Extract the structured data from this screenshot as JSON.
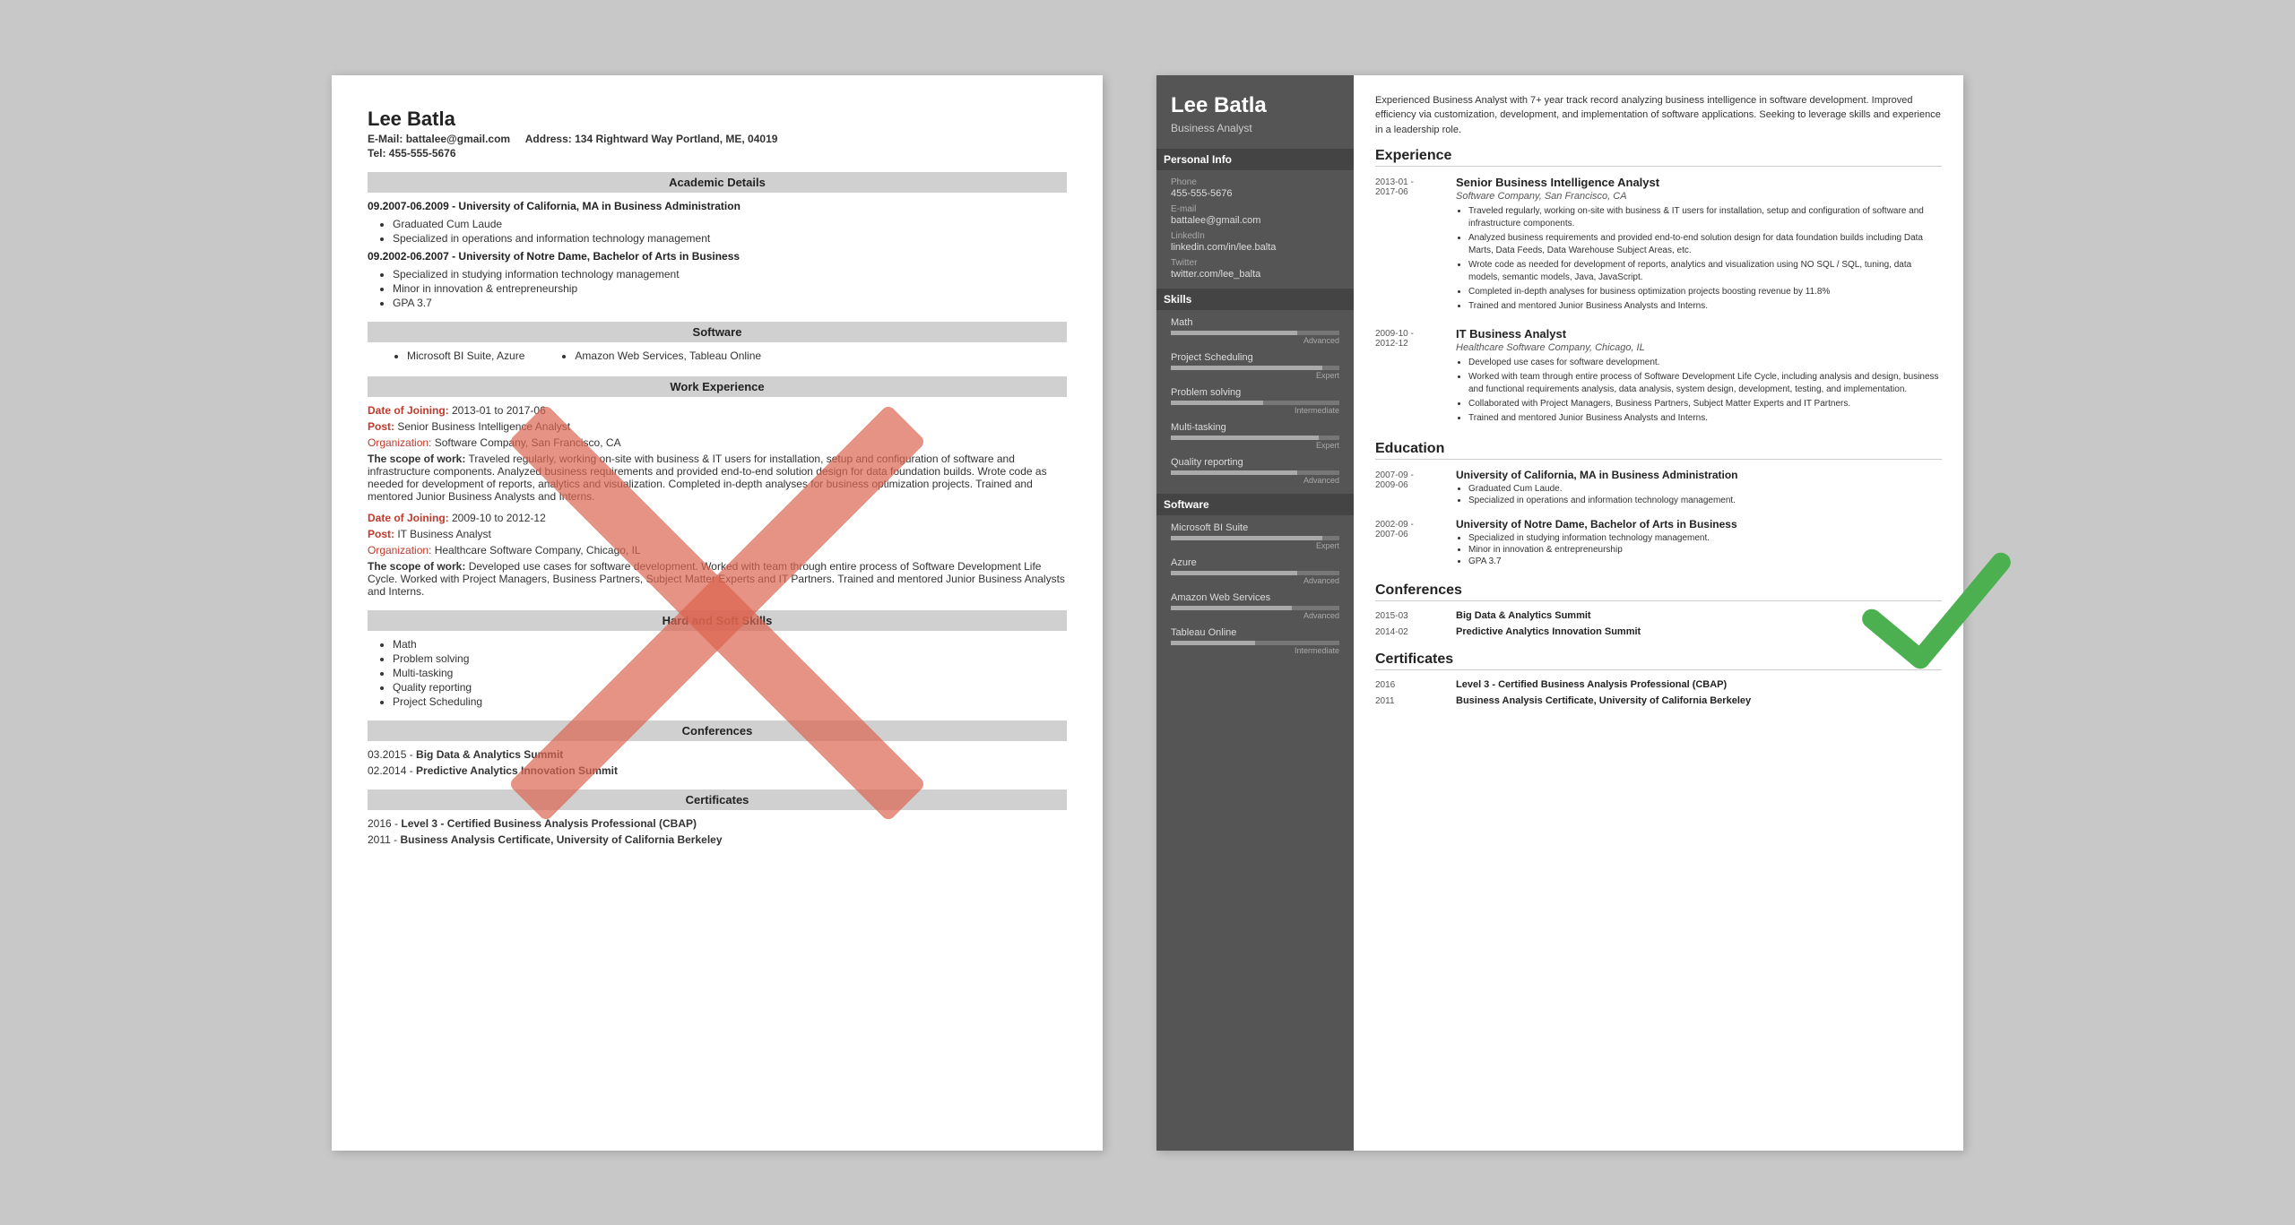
{
  "left_resume": {
    "name": "Lee Batla",
    "email_label": "E-Mail:",
    "email": "battalee@gmail.com",
    "address_label": "Address:",
    "address": "134 Rightward Way Portland, ME, 04019",
    "tel_label": "Tel:",
    "tel": "455-555-5676",
    "sections": {
      "academic": {
        "title": "Academic Details",
        "items": [
          {
            "date": "09.2007-06.2009",
            "degree": "University of California, MA in Business Administration",
            "bullets": [
              "Graduated Cum Laude",
              "Specialized in operations and information technology management"
            ]
          },
          {
            "date": "09.2002-06.2007",
            "degree": "University of Notre Dame, Bachelor of Arts in Business",
            "bullets": [
              "Specialized in studying information technology management",
              "Minor in innovation & entrepreneurship",
              "GPA 3.7"
            ]
          }
        ]
      },
      "software": {
        "title": "Software",
        "col1": [
          "Microsoft BI Suite, Azure"
        ],
        "col2": [
          "Amazon Web Services, Tableau Online"
        ]
      },
      "work": {
        "title": "Work Experience",
        "items": [
          {
            "dates": "Date of Joining: 2013-01 to 2017-06",
            "post": "Post: Senior Business Intelligence Analyst",
            "org": "Organization: Software Company, San Francisco, CA",
            "scope_label": "The scope of work:",
            "scope_text": "Traveled regularly, working on-site with business & IT users for installation, setup and configuration of software and infrastructure components. Analyzed business requirements and provided end-to-end solution design for data foundation builds. Wrote code as needed for development of reports, analytics and visualization. Completed in-depth analyses for business optimization projects. Trained and mentored Junior Business Analysts and Interns."
          },
          {
            "dates": "Date of Joining: 2009-10 to 2012-12",
            "post": "Post: IT Business Analyst",
            "org": "Organization: Healthcare Software Company, Chicago, IL",
            "scope_label": "The scope of work:",
            "scope_text": "Developed use cases for software development. Worked with team through entire process of Software Development Life Cycle. Worked with Project Managers, Business Partners, Subject Matter Experts and IT Partners. Trained and mentored Junior Business Analysts and Interns."
          }
        ]
      },
      "skills": {
        "title": "Hard and Soft Skills",
        "items": [
          "Math",
          "Problem solving",
          "Multi-tasking",
          "Quality reporting",
          "Project Scheduling"
        ]
      },
      "conferences": {
        "title": "Conferences",
        "items": [
          {
            "date": "03.2015",
            "name": "Big Data & Analytics Summit"
          },
          {
            "date": "02.2014",
            "name": "Predictive Analytics Innovation Summit"
          }
        ]
      },
      "certificates": {
        "title": "Certificates",
        "items": [
          {
            "date": "2016",
            "name": "Level 3 - Certified Business Analysis Professional (CBAP)"
          },
          {
            "date": "2011",
            "name": "Business Analysis Certificate, University of California Berkeley"
          }
        ]
      }
    }
  },
  "right_resume": {
    "name": "Lee Batla",
    "title": "Business Analyst",
    "summary": "Experienced Business Analyst with 7+ year track record analyzing business intelligence in software development. Improved efficiency via customization, development, and implementation of software applications. Seeking to leverage skills and experience in a leadership role.",
    "personal_info": {
      "section_title": "Personal Info",
      "phone_label": "Phone",
      "phone": "455-555-5676",
      "email_label": "E-mail",
      "email": "battalee@gmail.com",
      "linkedin_label": "LinkedIn",
      "linkedin": "linkedin.com/in/lee.balta",
      "twitter_label": "Twitter",
      "twitter": "twitter.com/lee_balta"
    },
    "skills": {
      "section_title": "Skills",
      "items": [
        {
          "name": "Math",
          "level": "Advanced",
          "pct": 75
        },
        {
          "name": "Project Scheduling",
          "level": "Expert",
          "pct": 90
        },
        {
          "name": "Problem solving",
          "level": "Intermediate",
          "pct": 55
        },
        {
          "name": "Multi-tasking",
          "level": "Expert",
          "pct": 88
        },
        {
          "name": "Quality reporting",
          "level": "Advanced",
          "pct": 75
        }
      ]
    },
    "software": {
      "section_title": "Software",
      "items": [
        {
          "name": "Microsoft BI Suite",
          "level": "Expert",
          "pct": 90
        },
        {
          "name": "Azure",
          "level": "Advanced",
          "pct": 75
        },
        {
          "name": "Amazon Web Services",
          "level": "Advanced",
          "pct": 72
        },
        {
          "name": "Tableau Online",
          "level": "Intermediate",
          "pct": 50
        }
      ]
    },
    "experience": {
      "section_title": "Experience",
      "items": [
        {
          "date": "2013-01 -\n2017-06",
          "job_title": "Senior Business Intelligence Analyst",
          "company": "Software Company, San Francisco, CA",
          "bullets": [
            "Traveled regularly, working on-site with business & IT users for installation, setup and configuration of software and infrastructure components.",
            "Analyzed business requirements and provided end-to-end solution design for data foundation builds including Data Marts, Data Feeds, Data Warehouse Subject Areas, etc.",
            "Wrote code as needed for development of reports, analytics and visualization using NO SQL / SQL, tuning, data models, semantic models, Java, JavaScript.",
            "Completed in-depth analyses for business optimization projects boosting revenue by 11.8%",
            "Trained and mentored Junior Business Analysts and Interns."
          ]
        },
        {
          "date": "2009-10 -\n2012-12",
          "job_title": "IT Business Analyst",
          "company": "Healthcare Software Company, Chicago, IL",
          "bullets": [
            "Developed use cases for software development.",
            "Worked with team through entire process of Software Development Life Cycle, including analysis and design, business and functional requirements analysis, data analysis, system design, development, testing, and implementation.",
            "Collaborated with Project Managers, Business Partners, Subject Matter Experts and IT Partners.",
            "Trained and mentored Junior Business Analysts and Interns."
          ]
        }
      ]
    },
    "education": {
      "section_title": "Education",
      "items": [
        {
          "date": "2007-09 -\n2009-06",
          "degree": "University of California, MA in Business Administration",
          "bullets": [
            "Graduated Cum Laude.",
            "Specialized in operations and information technology management."
          ]
        },
        {
          "date": "2002-09 -\n2007-06",
          "degree": "University of Notre Dame, Bachelor of Arts in Business",
          "bullets": [
            "Specialized in studying information technology management.",
            "Minor in innovation & entrepreneurship",
            "GPA 3.7"
          ]
        }
      ]
    },
    "conferences": {
      "section_title": "Conferences",
      "items": [
        {
          "date": "2015-03",
          "name": "Big Data & Analytics Summit"
        },
        {
          "date": "2014-02",
          "name": "Predictive Analytics Innovation Summit"
        }
      ]
    },
    "certificates": {
      "section_title": "Certificates",
      "items": [
        {
          "date": "2016",
          "name": "Level 3 - Certified Business Analysis Professional (CBAP)"
        },
        {
          "date": "2011",
          "name": "Business Analysis Certificate, University of California Berkeley"
        }
      ]
    }
  }
}
